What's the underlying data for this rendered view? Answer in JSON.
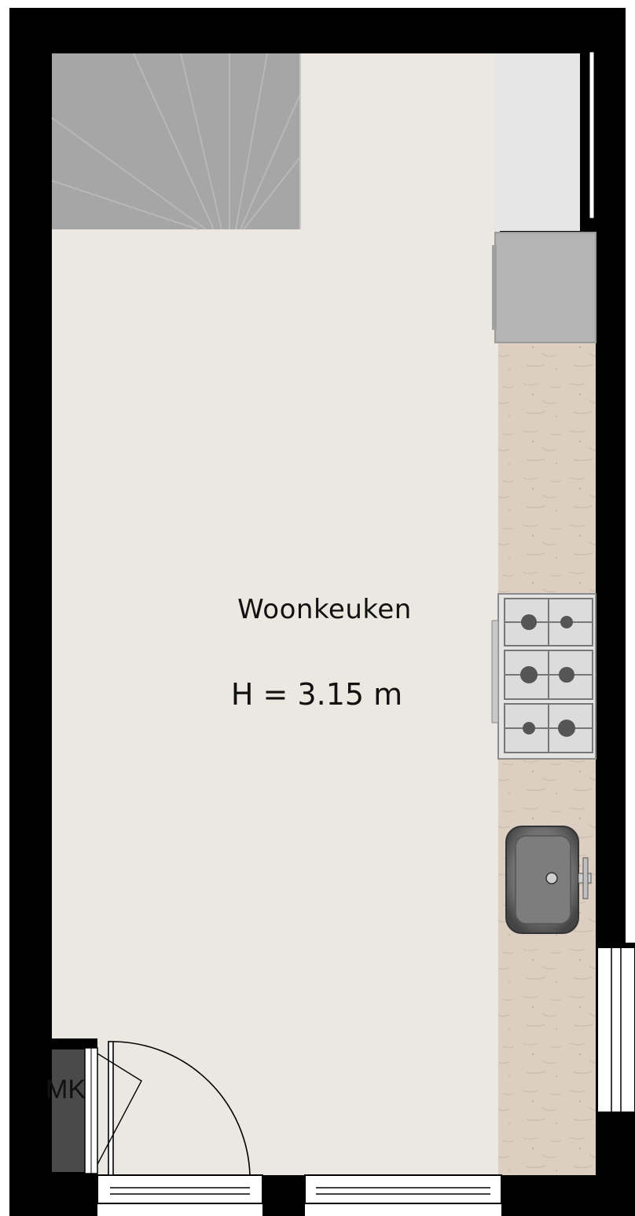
{
  "room": {
    "name": "Woonkeuken",
    "height_label": "H = 3.15 m"
  },
  "meter_cupboard": {
    "label": "MK"
  },
  "colors": {
    "wall": "#000000",
    "floor": "#ebe8e2",
    "stair": "#a3a3a3",
    "counter": "#d9cdbf",
    "appliance": "#b4b4b4",
    "sink": "#8a8a8a",
    "meter_box": "#4a4a4a"
  },
  "icons": [
    "staircase-icon",
    "fridge-icon",
    "stove-icon",
    "sink-icon",
    "door-swing-icon",
    "window-icon"
  ]
}
